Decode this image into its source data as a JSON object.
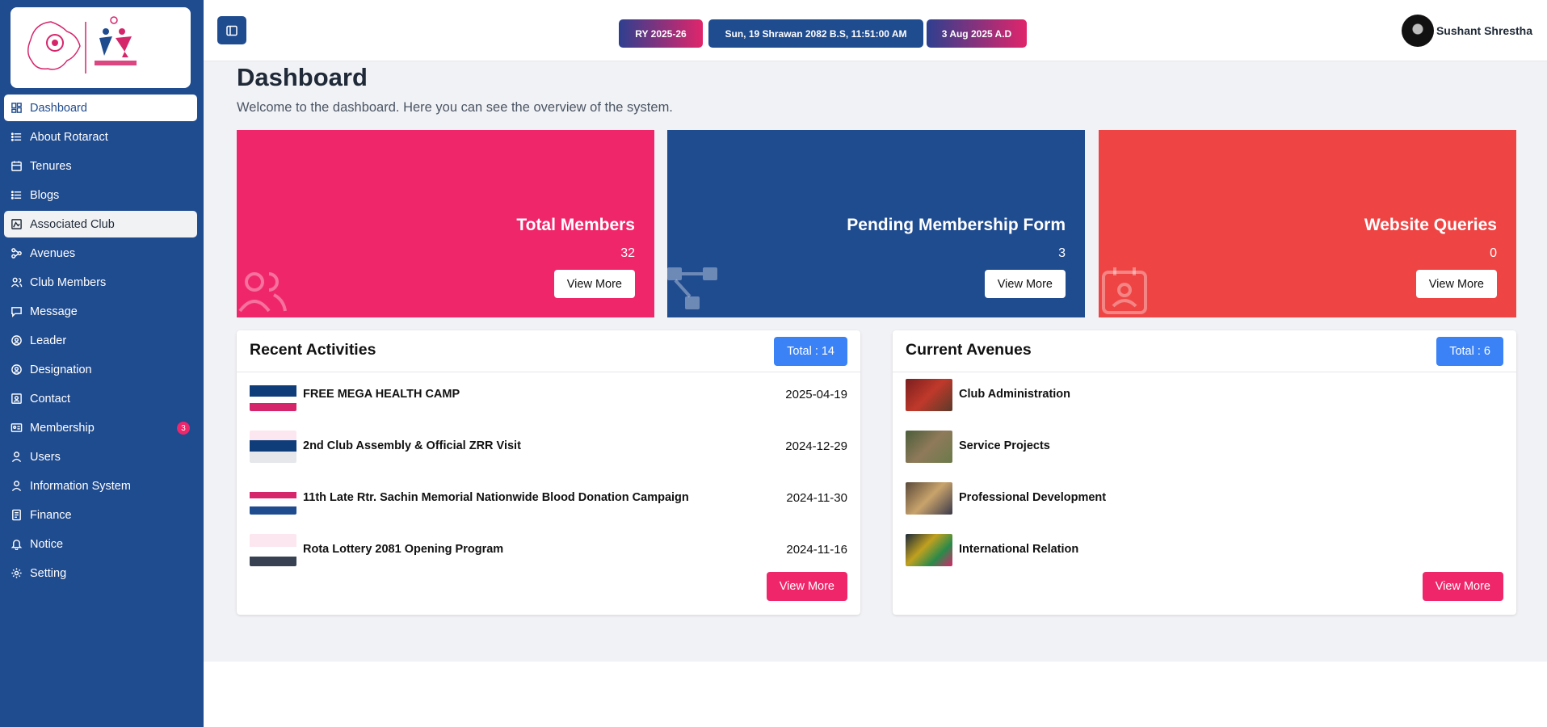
{
  "sidebar": {
    "items": [
      {
        "label": "Dashboard",
        "icon": "dashboard-icon"
      },
      {
        "label": "About Rotaract",
        "icon": "list-icon"
      },
      {
        "label": "Tenures",
        "icon": "calendar-icon"
      },
      {
        "label": "Blogs",
        "icon": "list-icon"
      },
      {
        "label": "Associated Club",
        "icon": "image-icon"
      },
      {
        "label": "Avenues",
        "icon": "avenues-icon"
      },
      {
        "label": "Club Members",
        "icon": "users-icon"
      },
      {
        "label": "Message",
        "icon": "message-icon"
      },
      {
        "label": "Leader",
        "icon": "leader-icon"
      },
      {
        "label": "Designation",
        "icon": "designation-icon"
      },
      {
        "label": "Contact",
        "icon": "contact-icon"
      },
      {
        "label": "Membership",
        "icon": "id-card-icon",
        "badge": "3"
      },
      {
        "label": "Users",
        "icon": "user-icon"
      },
      {
        "label": "Information System",
        "icon": "user-icon"
      },
      {
        "label": "Finance",
        "icon": "finance-icon"
      },
      {
        "label": "Notice",
        "icon": "bell-icon"
      },
      {
        "label": "Setting",
        "icon": "gear-icon"
      }
    ]
  },
  "topbar": {
    "chips": {
      "ry": "RY 2025-26",
      "bs_date": "Sun, 19 Shrawan 2082 B.S, 11:51:00 AM",
      "ad_date": "3 Aug 2025 A.D"
    },
    "user_name": "Sushant Shrestha"
  },
  "main": {
    "title": "Dashboard",
    "subtitle": "Welcome to the dashboard. Here you can see the overview of the system.",
    "stats": [
      {
        "label": "Total Members",
        "value": "32",
        "button": "View More",
        "color": "#f0266b"
      },
      {
        "label": "Pending Membership Form",
        "value": "3",
        "button": "View More",
        "color": "#1f4b8f"
      },
      {
        "label": "Website Queries",
        "value": "0",
        "button": "View More",
        "color": "#ef4444"
      }
    ],
    "activities": {
      "title": "Recent Activities",
      "total": "Total : 14",
      "items": [
        {
          "title": "FREE MEGA HEALTH CAMP",
          "date": "2025-04-19"
        },
        {
          "title": "2nd Club Assembly & Official ZRR Visit",
          "date": "2024-12-29"
        },
        {
          "title": "11th Late Rtr. Sachin Memorial Nationwide Blood Donation Campaign",
          "date": "2024-11-30"
        },
        {
          "title": "Rota Lottery 2081 Opening Program",
          "date": "2024-11-16"
        }
      ],
      "button": "View More"
    },
    "avenues": {
      "title": "Current Avenues",
      "total": "Total : 6",
      "items": [
        {
          "title": "Club Administration"
        },
        {
          "title": "Service Projects"
        },
        {
          "title": "Professional Development"
        },
        {
          "title": "International Relation"
        }
      ],
      "button": "View More"
    }
  },
  "colors": {
    "primary": "#1f4b8f",
    "accent": "#f0266b",
    "info": "#3b82f6",
    "danger": "#ef4444"
  }
}
